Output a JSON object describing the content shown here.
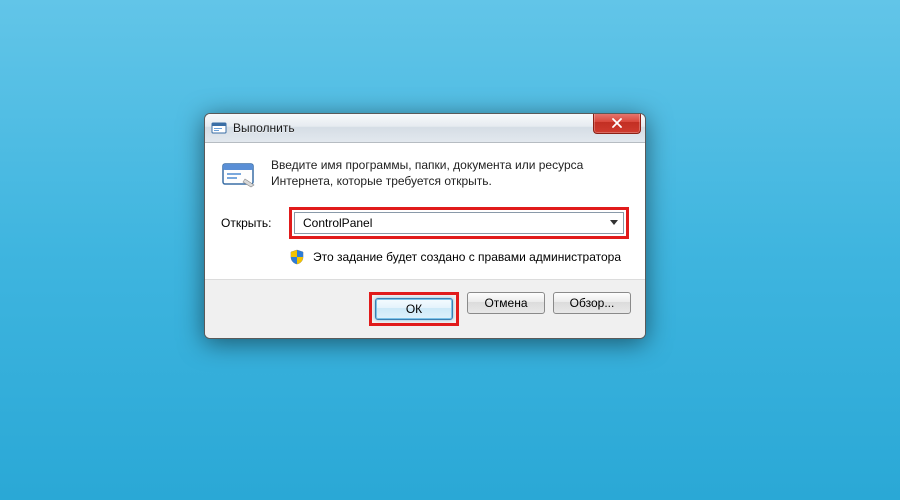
{
  "window": {
    "title": "Выполнить",
    "description": "Введите имя программы, папки, документа или ресурса Интернета, которые требуется открыть."
  },
  "open": {
    "label": "Открыть:",
    "value": "ControlPanel"
  },
  "admin_notice": "Это задание будет создано с правами администратора",
  "buttons": {
    "ok": "ОК",
    "cancel": "Отмена",
    "browse": "Обзор..."
  }
}
